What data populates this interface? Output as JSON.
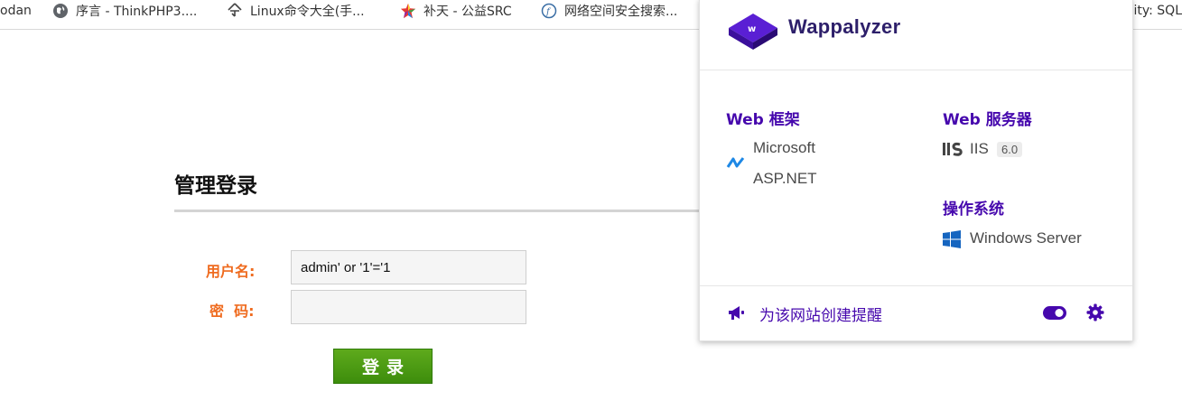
{
  "bookmarks": [
    {
      "label": "odan",
      "icon": "none"
    },
    {
      "label": "序言 - ThinkPHP3....",
      "icon": "globe-icon"
    },
    {
      "label": "Linux命令大全(手...",
      "icon": "linux-command-icon"
    },
    {
      "label": "补天 - 公益SRC",
      "icon": "butian-star-icon"
    },
    {
      "label": "网络空间安全搜索...",
      "icon": "fofa-icon"
    }
  ],
  "bookmarks_overflow": "ity: SQL",
  "login": {
    "title": "管理登录",
    "username_label": "用户名:",
    "username_value": "admin' or '1'='1",
    "password_label": "密  码:",
    "password_value": "",
    "submit_label": "登录"
  },
  "wappalyzer": {
    "brand": "Wappalyzer",
    "brand_color": "#4608ad",
    "categories": {
      "web_framework": {
        "title": "Web 框架",
        "tech": {
          "name_line1": "Microsoft",
          "name_line2": "ASP.NET",
          "icon": "aspnet-icon"
        }
      },
      "web_server": {
        "title": "Web 服务器",
        "tech": {
          "name": "IIS",
          "version": "6.0",
          "icon": "iis-icon"
        }
      },
      "os": {
        "title": "操作系统",
        "tech": {
          "name": "Windows Server",
          "icon": "windows-icon"
        }
      }
    },
    "footer": {
      "alert_label": "为该网站创建提醒",
      "toggle_state": "on"
    }
  }
}
